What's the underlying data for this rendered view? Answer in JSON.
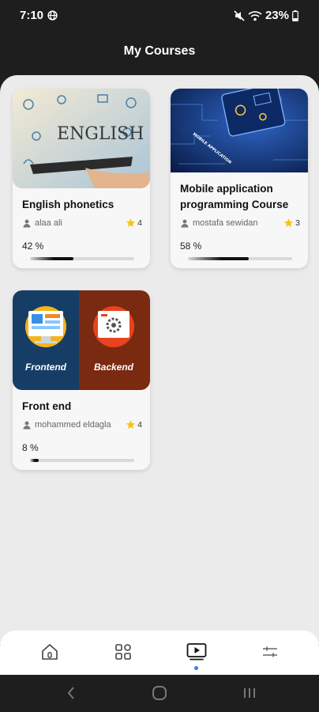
{
  "status_bar": {
    "time": "7:10",
    "battery": "23%",
    "icons": [
      "globe-icon",
      "mute-icon",
      "wifi-icon",
      "battery-icon"
    ]
  },
  "header": {
    "title": "My Courses"
  },
  "courses": [
    {
      "title": "English phonetics",
      "author": "alaa ali",
      "rating": "4",
      "progress_text": "42 %",
      "progress": 0.42,
      "image_text": "ENGLISH"
    },
    {
      "title": "Mobile application programming Course",
      "author": "mostafa sewidan",
      "rating": "3",
      "progress_text": "58 %",
      "progress": 0.58,
      "image_text": "MOBILE APPLICATION"
    },
    {
      "title": "Front end",
      "author": "mohammed eldagla",
      "rating": "4",
      "progress_text": "8 %",
      "progress": 0.08,
      "image_left_label": "Frontend",
      "image_right_label": "Backend"
    }
  ],
  "bottom_nav": {
    "items": [
      "home-icon",
      "grid-icon",
      "courses-icon",
      "settings-icon"
    ],
    "active": "courses-icon",
    "active_color": "#2d7ff9"
  },
  "system_nav": [
    "back-icon",
    "home-circle-icon",
    "recents-icon"
  ]
}
